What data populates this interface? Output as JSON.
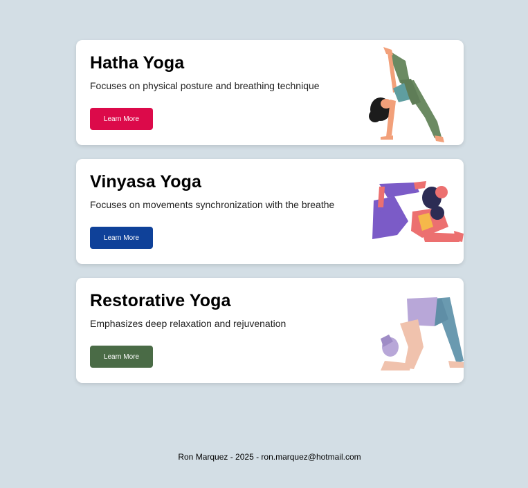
{
  "cards": [
    {
      "title": "Hatha Yoga",
      "description": "Focuses on physical posture and breathing technique",
      "button_label": "Learn More",
      "button_color": "#dc0a4a"
    },
    {
      "title": "Vinyasa Yoga",
      "description": "Focuses on movements synchronization with the breathe",
      "button_label": "Learn More",
      "button_color": "#0f4199"
    },
    {
      "title": "Restorative Yoga",
      "description": "Emphasizes deep relaxation and rejuvenation",
      "button_label": "Learn More",
      "button_color": "#4a6b46"
    }
  ],
  "footer": {
    "text": "Ron Marquez - 2025 - ron.marquez@hotmail.com"
  },
  "colors": {
    "page_background": "#d3dee5",
    "card_background": "#ffffff"
  }
}
